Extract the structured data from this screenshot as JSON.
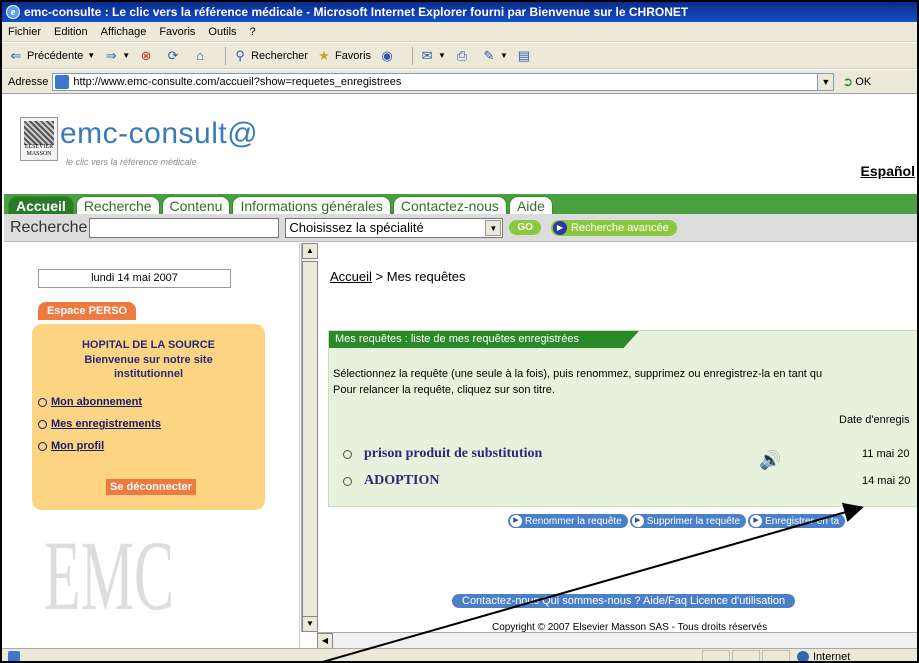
{
  "window": {
    "title": "emc-consulte : Le clic vers la référence médicale - Microsoft Internet Explorer fourni par Bienvenue sur le CHRONET"
  },
  "menu": [
    "Fichier",
    "Edition",
    "Affichage",
    "Favoris",
    "Outils",
    "?"
  ],
  "toolbar": {
    "back": "Précédente",
    "search": "Rechercher",
    "favorites": "Favoris"
  },
  "address": {
    "label": "Adresse",
    "url": "http://www.emc-consulte.com/accueil?show=requetes_enregistrees",
    "go": "OK"
  },
  "site": {
    "brand": "emc-consult@",
    "tagline": "le clic vers la référence médicale",
    "publisher_logo": "ELSEVIER MASSON",
    "lang": "Español"
  },
  "nav": [
    "Accueil",
    "Recherche",
    "Contenu",
    "Informations générales",
    "Contactez-nous",
    "Aide"
  ],
  "search": {
    "label": "Recherche",
    "specialty": "Choisissez la spécialité",
    "go": "GO",
    "advanced": "Recherche avancée"
  },
  "left": {
    "date": "lundi 14 mai 2007",
    "perso_tab": "Espace PERSO",
    "hospital": "HOPITAL DE LA SOURCE",
    "welcome_1": "Bienvenue sur notre site",
    "welcome_2": "institutionnel",
    "links": [
      "Mon abonnement",
      "Mes enregistrements",
      "Mon profil"
    ],
    "logout": "Se déconnecter",
    "emc_logo": "EMC"
  },
  "content": {
    "breadcrumb_home": "Accueil",
    "breadcrumb_sep": " > ",
    "breadcrumb_current": "Mes requêtes",
    "panel_header": "Mes requêtes : liste de mes requêtes enregistrées",
    "instruction_1": "Sélectionnez la requête (une seule à la fois), puis renommez, supprimez ou enregistrez-la en tant qu",
    "instruction_2": "Pour relancer la requête, cliquez sur son titre.",
    "date_header": "Date d'enregis",
    "requests": [
      {
        "title": "prison produit de substitution",
        "date": "11 mai 20"
      },
      {
        "title": "ADOPTION",
        "date": "14 mai 20"
      }
    ],
    "actions": [
      "Renommer la requête",
      "Supprimer la requête",
      "Enregistrer en ta"
    ],
    "footer_links": "Contactez-nous  Qui sommes-nous ?  Aide/Faq  Licence d'utilisation",
    "copyright": "Copyright © 2007 Elsevier Masson SAS - Tous droits réservés"
  },
  "status": {
    "zone": "Internet"
  }
}
